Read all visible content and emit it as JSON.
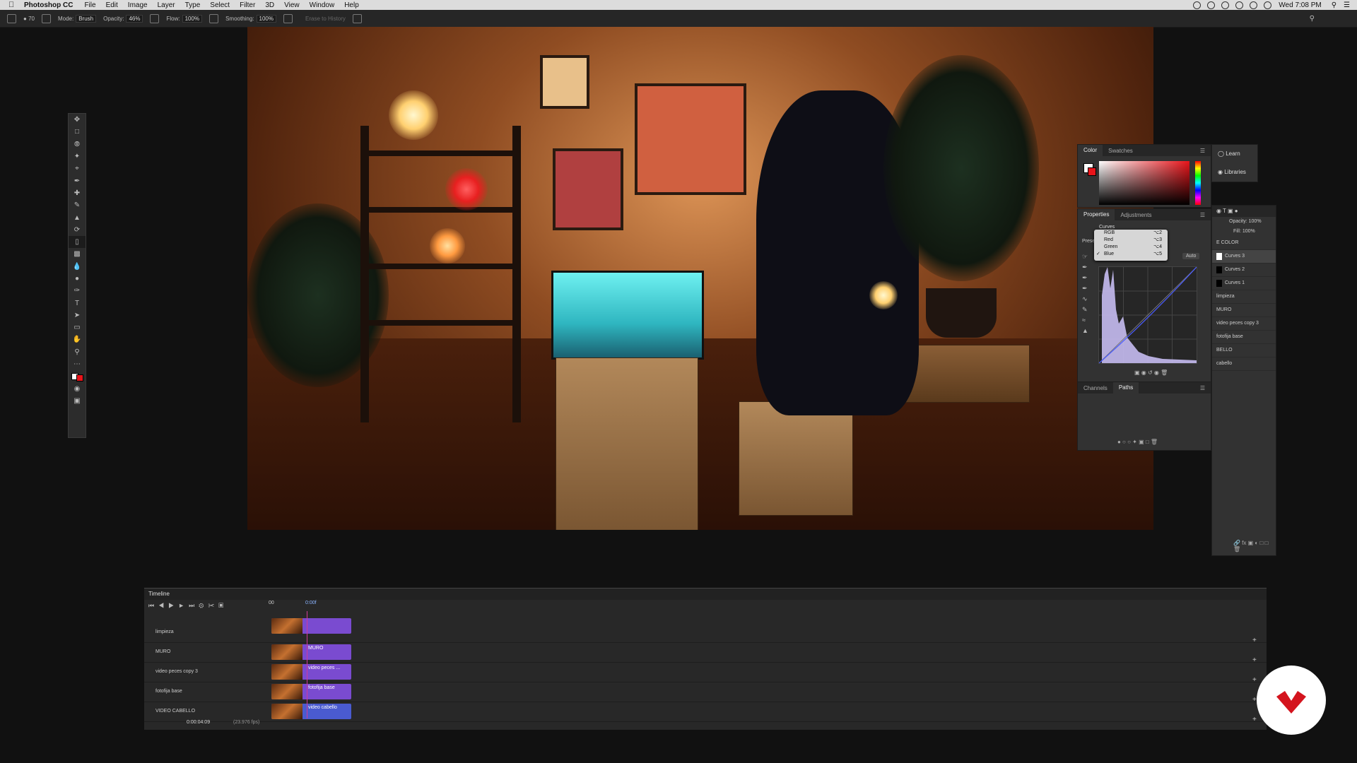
{
  "menubar": {
    "app": "Photoshop CC",
    "items": [
      "File",
      "Edit",
      "Image",
      "Layer",
      "Type",
      "Select",
      "Filter",
      "3D",
      "View",
      "Window",
      "Help"
    ],
    "clock": "Wed 7:08 PM"
  },
  "options": {
    "size": "70",
    "mode_label": "Mode:",
    "mode_value": "Brush",
    "opacity_label": "Opacity:",
    "opacity_value": "46%",
    "flow_label": "Flow:",
    "flow_value": "100%",
    "smoothing_label": "Smoothing:",
    "smoothing_value": "100%",
    "erase_history": "Erase to History"
  },
  "toolbar": {
    "tools": [
      "move-tool",
      "marquee-tool",
      "lasso-tool",
      "quick-select-tool",
      "crop-tool",
      "eyedropper-tool",
      "healing-tool",
      "brush-tool",
      "stamp-tool",
      "history-brush-tool",
      "eraser-tool",
      "gradient-tool",
      "blur-tool",
      "dodge-tool",
      "pen-tool",
      "type-tool",
      "path-select-tool",
      "rectangle-tool",
      "hand-tool",
      "zoom-tool",
      "more-tools",
      "swap-colors",
      "fg-bg-colors",
      "quick-mask",
      "screen-mode"
    ]
  },
  "color_panel": {
    "tabs": [
      "Color",
      "Swatches"
    ],
    "foreground": "#ffffff",
    "background": "#e8141a"
  },
  "learn_panel": {
    "learn": "Learn",
    "libraries": "Libraries"
  },
  "properties_panel": {
    "tabs": [
      "Properties",
      "Adjustments"
    ],
    "title": "Curves",
    "preset_label": "Prese",
    "auto_label": "Auto",
    "channel_menu": [
      {
        "label": "RGB",
        "key": "⌥2",
        "selected": false
      },
      {
        "label": "Red",
        "key": "⌥3",
        "selected": false
      },
      {
        "label": "Green",
        "key": "⌥4",
        "selected": false
      },
      {
        "label": "Blue",
        "key": "⌥5",
        "selected": true
      }
    ]
  },
  "layers_panel": {
    "opacity_label": "Opacity:",
    "opacity_value": "100%",
    "fill_label": "Fill:",
    "fill_value": "100%",
    "layers": [
      "E COLOR",
      "Curves 3",
      "Curves 2",
      "Curves 1",
      "limpieza",
      "MURO",
      "video peces copy 3",
      "fotofija base",
      "BELLO",
      "cabello"
    ]
  },
  "channels_panel": {
    "tabs": [
      "Channels",
      "Paths"
    ]
  },
  "timeline": {
    "title": "Timeline",
    "ruler_start": "00",
    "ruler_mark": "0:00f",
    "timecode": "0:00:04:09",
    "fps": "(23.976 fps)",
    "tracks": [
      {
        "name": "limpieza",
        "clip": ""
      },
      {
        "name": "MURO",
        "clip": "MURO"
      },
      {
        "name": "video peces copy 3",
        "clip": "video peces ..."
      },
      {
        "name": "fotofija base",
        "clip": "fotofija base"
      },
      {
        "name": "VIDEO CABELLO",
        "clip": "video cabello"
      }
    ]
  },
  "colors": {
    "accent": "#2f6bd8",
    "clip": "#7a4bd0",
    "playhead": "#d03a9a",
    "logo": "#d4141e"
  }
}
